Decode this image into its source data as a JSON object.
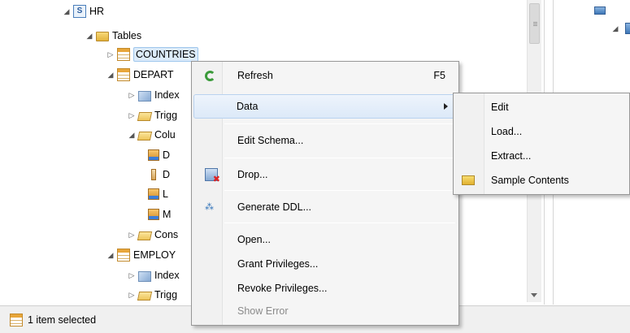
{
  "tree": {
    "schema_label": "HR",
    "tables_label": "Tables",
    "countries_label": "COUNTRIES",
    "departments_label": "DEPART",
    "indexes1_label": "Index",
    "triggers1_label": "Trigg",
    "columns_label": "Colu",
    "col1_label": "D",
    "col2_label": "D",
    "col3_label": "L",
    "col4_label": "M",
    "constraints_label": "Cons",
    "employees_label": "EMPLOY",
    "indexes2_label": "Index",
    "triggers2_label": "Trigg"
  },
  "context_menu": {
    "refresh": "Refresh",
    "refresh_shortcut": "F5",
    "data": "Data",
    "edit_schema": "Edit Schema...",
    "drop": "Drop...",
    "generate_ddl": "Generate DDL...",
    "open": "Open...",
    "grant_privileges": "Grant Privileges...",
    "revoke_privileges": "Revoke Privileges...",
    "show_error": "Show Error"
  },
  "submenu": {
    "edit": "Edit",
    "load": "Load...",
    "extract": "Extract...",
    "sample_contents": "Sample Contents"
  },
  "status_bar": {
    "text": "1 item selected"
  },
  "colors": {
    "highlight_bg": "#dce9f8",
    "highlight_border": "#b9d2ef",
    "menu_bg": "#f5f5f5",
    "status_bg": "#f0f0f0"
  }
}
